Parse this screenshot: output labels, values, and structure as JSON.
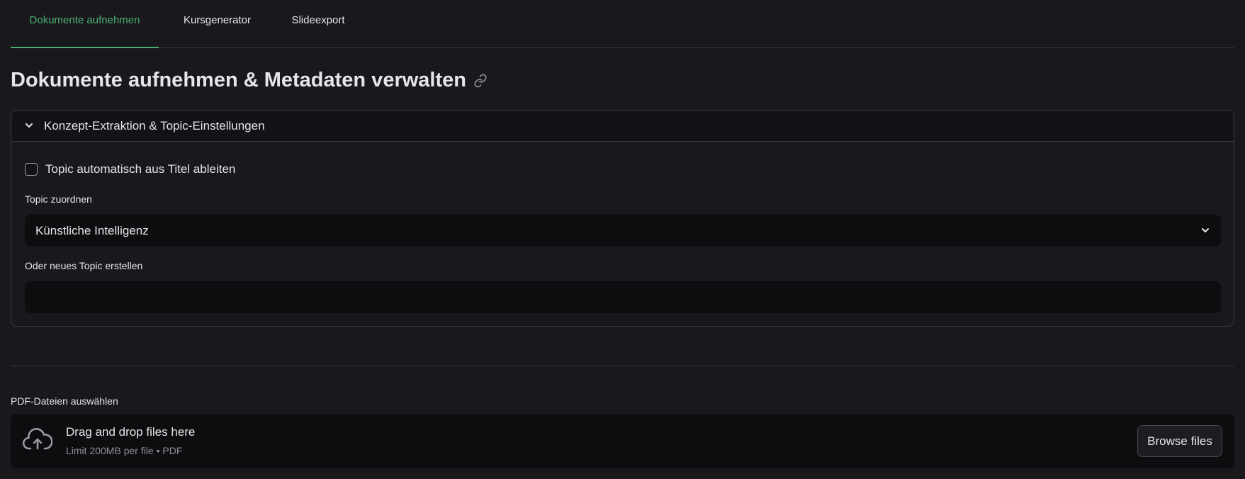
{
  "tabs": [
    {
      "label": "Dokumente aufnehmen",
      "active": true
    },
    {
      "label": "Kursgenerator",
      "active": false
    },
    {
      "label": "Slideexport",
      "active": false
    }
  ],
  "page_title": "Dokumente aufnehmen & Metadaten verwalten",
  "expander": {
    "title": "Konzept-Extraktion & Topic-Einstellungen",
    "expanded": true,
    "checkbox_label": "Topic automatisch aus Titel ableiten",
    "checkbox_checked": false,
    "select_label": "Topic zuordnen",
    "select_value": "Künstliche Intelligenz",
    "new_topic_label": "Oder neues Topic erstellen",
    "new_topic_value": ""
  },
  "uploader": {
    "label": "PDF-Dateien auswählen",
    "drop_text": "Drag and drop files here",
    "limit_text": "Limit 200MB per file • PDF",
    "browse_label": "Browse files"
  },
  "colors": {
    "accent": "#4caf72",
    "background": "#18181d",
    "input_background": "#0d0d10",
    "border": "#3a3b42"
  }
}
